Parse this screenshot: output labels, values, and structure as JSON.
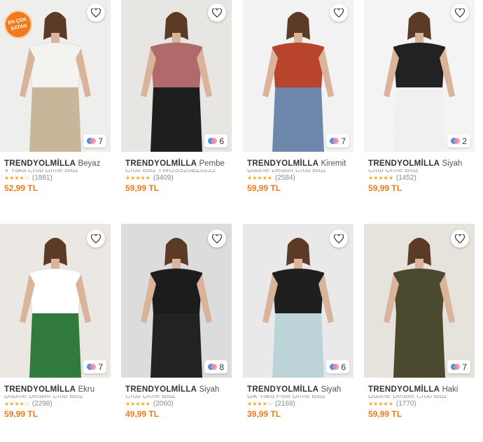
{
  "badge_text": "EN ÇOK SATAN",
  "colors": {
    "accent": "#f27a1a",
    "star": "#f5a623",
    "rating_text": "#8a8a8a"
  },
  "products": [
    {
      "brand": "TRENDYOLMİLLA",
      "name": "Beyaz",
      "subtitle": "V Yaka Crop Örme Bluz",
      "rating": 4,
      "rating_count": "(1881)",
      "price": "52,99 TL",
      "color_count": "7",
      "best_seller": true
    },
    {
      "brand": "TRENDYOLMİLLA",
      "name": "Pembe",
      "subtitle": "Crop Bluz TWOSS20BZ0222",
      "rating": 5,
      "rating_count": "(3409)",
      "price": "59,99 TL",
      "color_count": "6",
      "best_seller": false
    },
    {
      "brand": "TRENDYOLMİLLA",
      "name": "Kiremit",
      "subtitle": "Düğme Detaylı Crop Bluz",
      "rating": 4.5,
      "rating_count": "(2584)",
      "price": "59,99 TL",
      "color_count": "7",
      "best_seller": false
    },
    {
      "brand": "TRENDYOLMİLLA",
      "name": "Siyah",
      "subtitle": "Crop Örme Bluz",
      "rating": 5,
      "rating_count": "(1452)",
      "price": "59,99 TL",
      "color_count": "2",
      "best_seller": false
    },
    {
      "brand": "TRENDYOLMİLLA",
      "name": "Ekru",
      "subtitle": "Düğme Detaylı Crop Bluz",
      "rating": 4,
      "rating_count": "(2298)",
      "price": "59,99 TL",
      "color_count": "7",
      "best_seller": false
    },
    {
      "brand": "TRENDYOLMİLLA",
      "name": "Siyah",
      "subtitle": "Crop Örme Bluz",
      "rating": 4.5,
      "rating_count": "(2060)",
      "price": "49,99 TL",
      "color_count": "8",
      "best_seller": false
    },
    {
      "brand": "TRENDYOLMİLLA",
      "name": "Siyah",
      "subtitle": "Dik Yaka Fitilli Örme Bluz",
      "rating": 4,
      "rating_count": "(2169)",
      "price": "39,99 TL",
      "color_count": "6",
      "best_seller": false
    },
    {
      "brand": "TRENDYOLMİLLA",
      "name": "Haki",
      "subtitle": "Düğme Detaylı Crop Bluz",
      "rating": 4.5,
      "rating_count": "(1770)",
      "price": "59,99 TL",
      "color_count": "7",
      "best_seller": false
    }
  ]
}
